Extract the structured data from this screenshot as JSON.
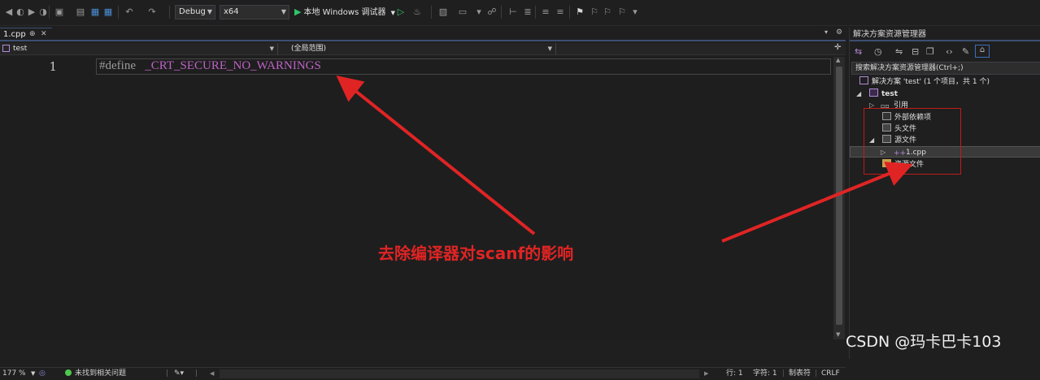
{
  "toolbar": {
    "config": "Debug",
    "platform": "x64",
    "run_label": "本地 Windows 调试器"
  },
  "editor": {
    "tab_label": "1.cpp",
    "tab_pin": "⊕",
    "tab_close": "✕",
    "nav_project": "test",
    "nav_scope": "(全局范围)",
    "nav_member": "",
    "line_number": "1",
    "code_keyword": "#define",
    "code_macro": "_CRT_SECURE_NO_WARNINGS"
  },
  "statusbar": {
    "zoom": "177 %",
    "issues": "未找到相关问题",
    "line": "行: 1",
    "col": "字符: 1",
    "indent": "制表符",
    "eol": "CRLF"
  },
  "solution_explorer": {
    "title": "解决方案资源管理器",
    "search_placeholder": "搜索解决方案资源管理器(Ctrl+;)",
    "tree": {
      "solution": "解决方案 'test' (1 个项目，共 1 个)",
      "project": "test",
      "references": "引用",
      "external_deps": "外部依赖项",
      "headers": "头文件",
      "sources": "源文件",
      "file": "1.cpp",
      "resources": "资源文件"
    }
  },
  "annotation": {
    "text": "去除编译器对scanf的影响",
    "color": "#e02424"
  },
  "watermark": "CSDN @玛卡巴卡103"
}
